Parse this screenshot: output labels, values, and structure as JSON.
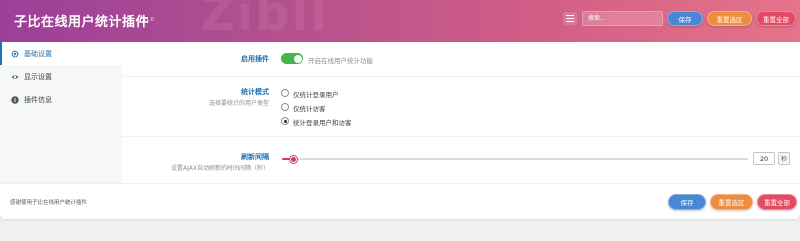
{
  "header": {
    "title": "子比在线用户统计插件",
    "version": "v1.0",
    "search_placeholder": "搜索...",
    "save_label": "保存",
    "reset_section_label": "重置选区",
    "reset_all_label": "重置全部"
  },
  "sidebar": {
    "items": [
      {
        "label": "基础设置",
        "icon": "gear-icon",
        "active": true
      },
      {
        "label": "显示设置",
        "icon": "eye-icon",
        "active": false
      },
      {
        "label": "插件信息",
        "icon": "info-icon",
        "active": false
      }
    ]
  },
  "settings": {
    "enable": {
      "label": "启用插件",
      "toggle_on": true,
      "toggle_text": "开启在线用户统计功能"
    },
    "mode": {
      "label": "统计模式",
      "desc": "选择要统计的用户类型",
      "options": [
        "仅统计登录用户",
        "仅统计访客",
        "统计登录用户和访客"
      ],
      "selected_index": 2
    },
    "refresh": {
      "label": "刷新间隔",
      "desc": "设置AJAX自动刷新的时间间隔（秒）",
      "value": "20",
      "unit": "秒",
      "slider_fraction": 0.02
    }
  },
  "footer": {
    "text": "感谢使用子比在线用户统计插件",
    "save_label": "保存",
    "reset_section_label": "重置选区",
    "reset_all_label": "重置全部"
  },
  "colors": {
    "accent": "#2271b1",
    "toggle_on": "#46b450",
    "slider": "#d63864",
    "save": "#4a86d3",
    "reset_section": "#ee8c3f",
    "reset_all": "#e44b63"
  }
}
